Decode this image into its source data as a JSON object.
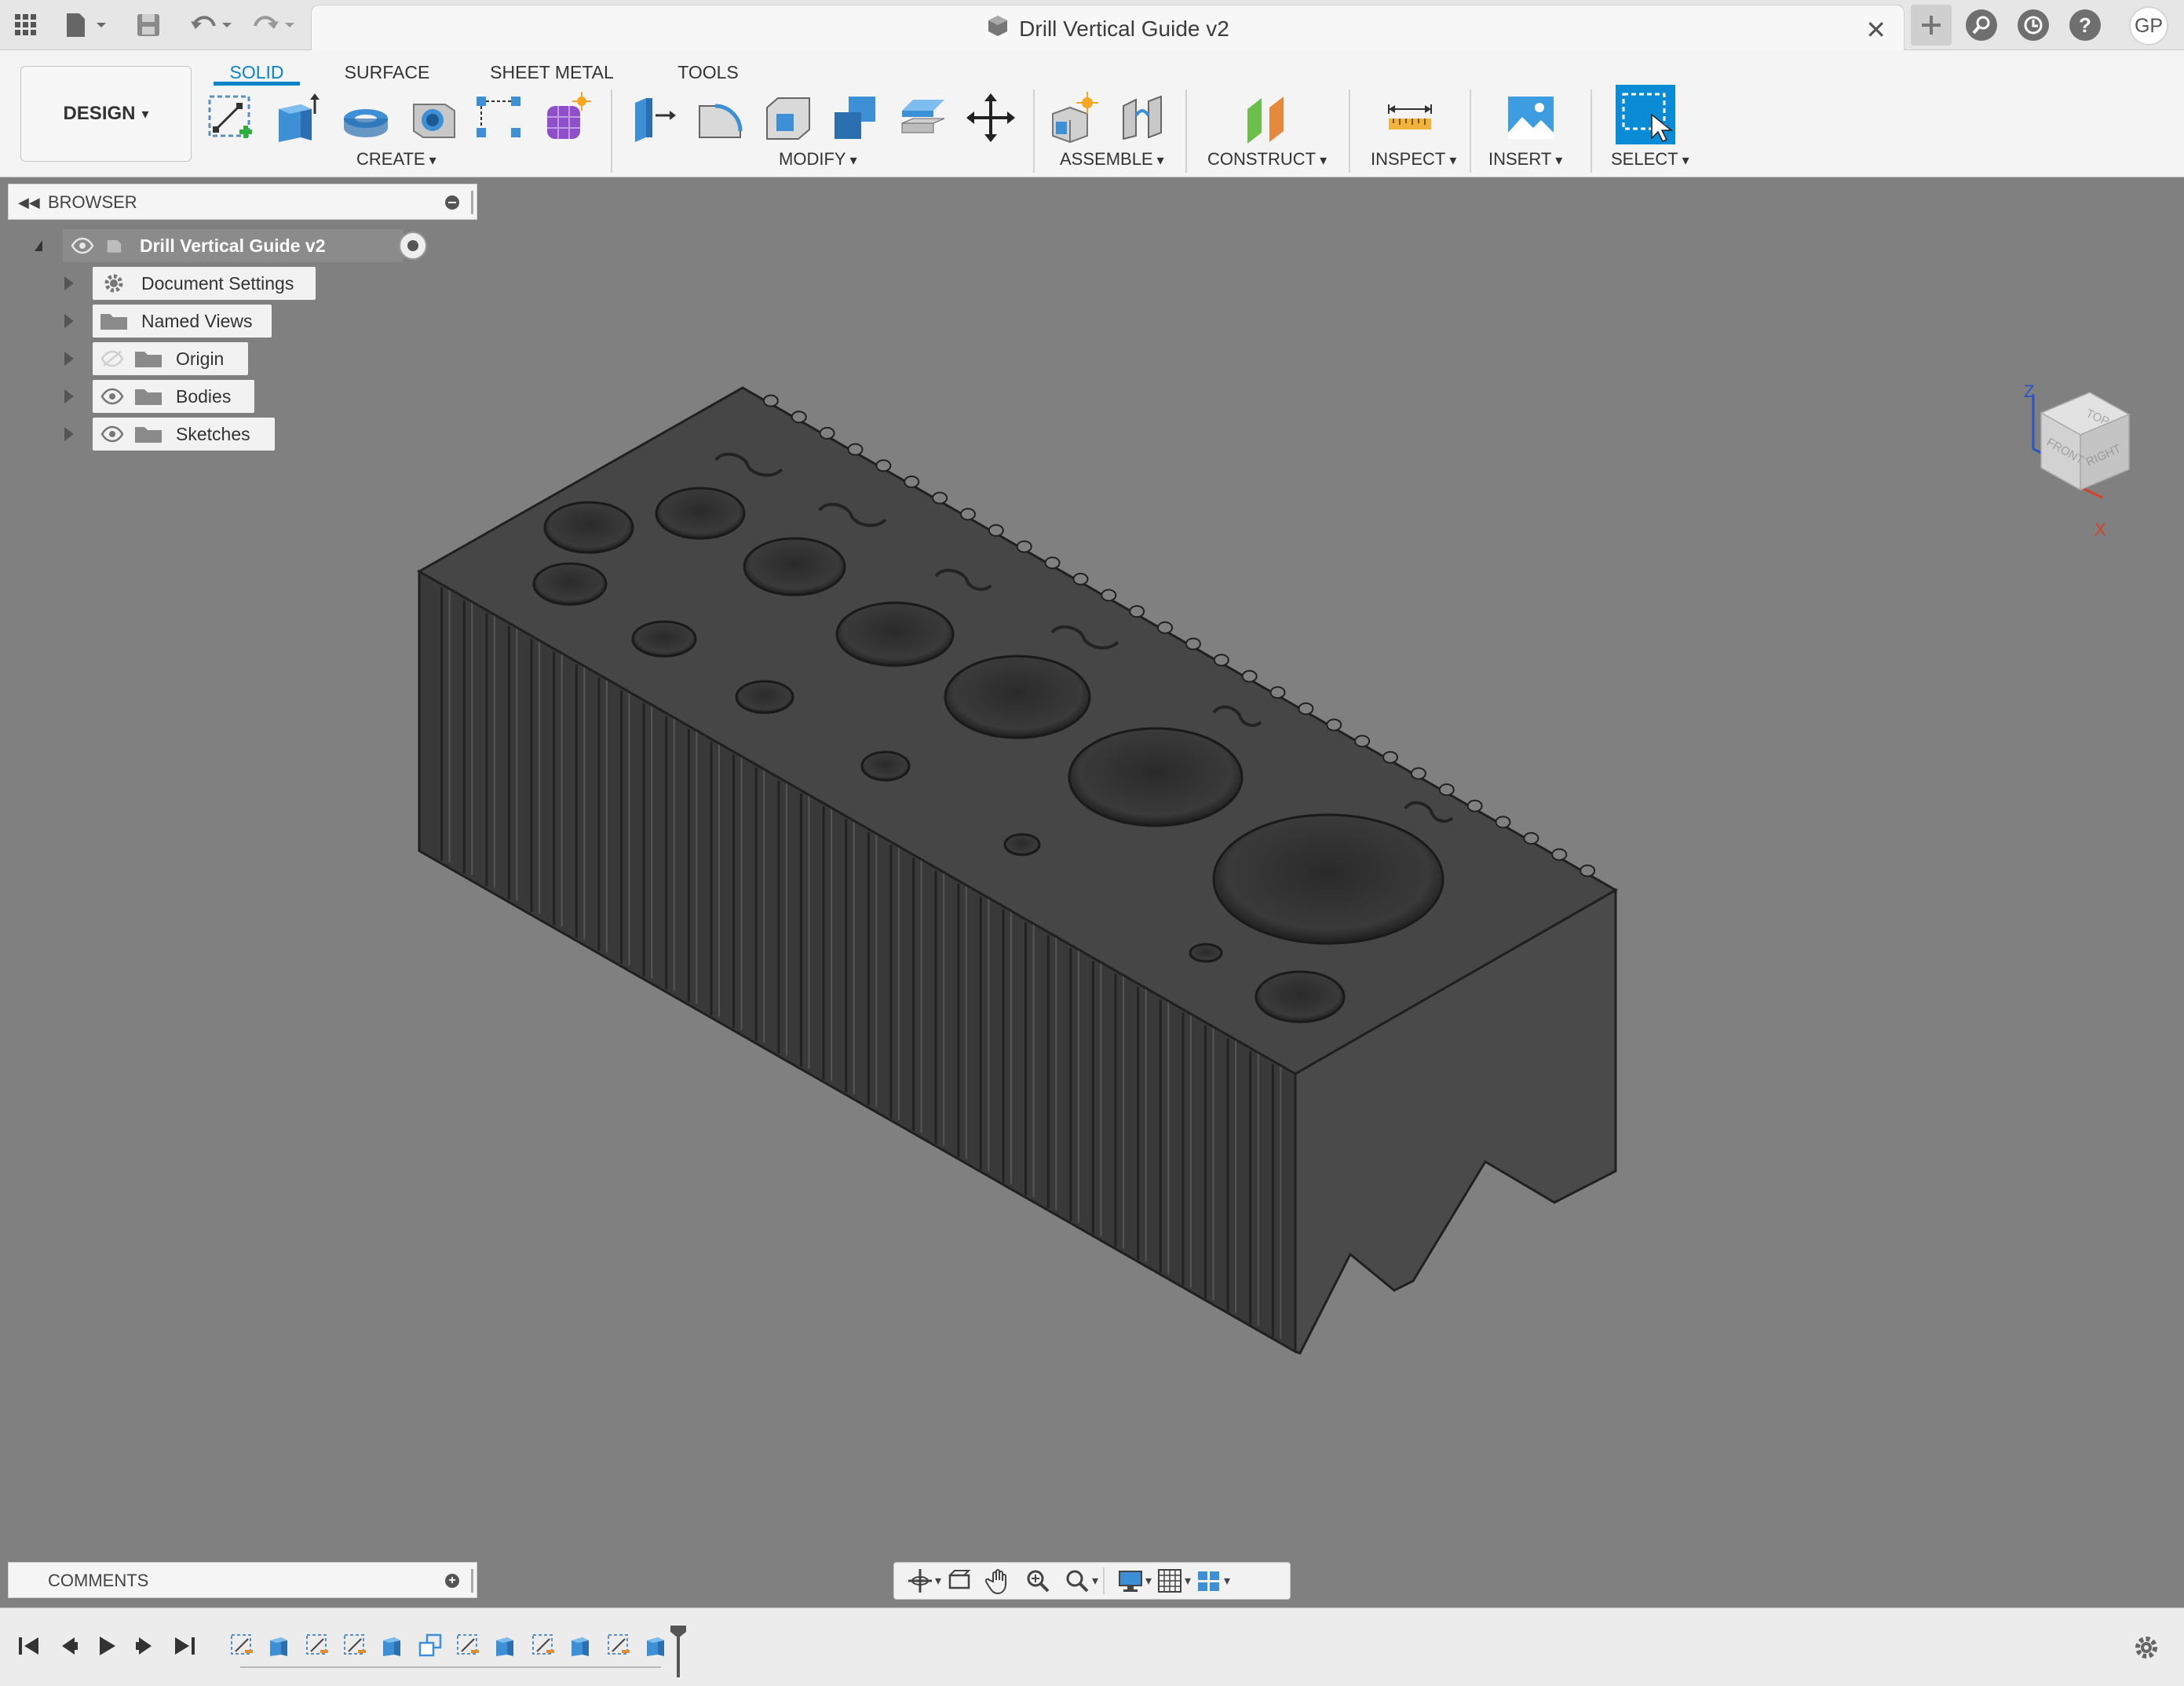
{
  "app": {
    "document_title": "Drill Vertical Guide v2",
    "user_initials": "GP"
  },
  "titlebar": {
    "icons": [
      "apps-grid-icon",
      "file-menu-icon",
      "save-icon",
      "undo-icon",
      "redo-icon"
    ],
    "right_icons": [
      "new-tab-plus-icon",
      "extensions-icon",
      "job-status-icon",
      "help-icon"
    ]
  },
  "toolbar": {
    "workspace_button": "DESIGN",
    "tabs": [
      {
        "label": "SOLID",
        "active": true
      },
      {
        "label": "SURFACE",
        "active": false
      },
      {
        "label": "SHEET METAL",
        "active": false
      },
      {
        "label": "TOOLS",
        "active": false
      }
    ],
    "groups": [
      {
        "label": "CREATE",
        "tools": [
          "create-sketch",
          "extrude",
          "revolve",
          "hole",
          "rectangular-pattern",
          "create-form"
        ]
      },
      {
        "label": "MODIFY",
        "tools": [
          "press-pull",
          "fillet",
          "shell",
          "combine",
          "offset-face",
          "move-copy"
        ]
      },
      {
        "label": "ASSEMBLE",
        "tools": [
          "new-component",
          "joint"
        ]
      },
      {
        "label": "CONSTRUCT",
        "tools": [
          "offset-plane"
        ]
      },
      {
        "label": "INSPECT",
        "tools": [
          "measure"
        ]
      },
      {
        "label": "INSERT",
        "tools": [
          "insert-image"
        ]
      },
      {
        "label": "SELECT",
        "tools": [
          "select"
        ]
      }
    ]
  },
  "browser": {
    "title": "BROWSER",
    "root": "Drill Vertical Guide v2",
    "items": [
      {
        "label": "Document Settings",
        "icon": "gear-icon",
        "eye": "none"
      },
      {
        "label": "Named Views",
        "icon": "folder-icon",
        "eye": "none"
      },
      {
        "label": "Origin",
        "icon": "folder-icon",
        "eye": "hidden"
      },
      {
        "label": "Bodies",
        "icon": "folder-icon",
        "eye": "visible"
      },
      {
        "label": "Sketches",
        "icon": "folder-icon",
        "eye": "visible"
      }
    ]
  },
  "viewcube": {
    "faces": [
      "TOP",
      "FRONT",
      "RIGHT"
    ],
    "axes": [
      "Z",
      "X"
    ]
  },
  "comments": {
    "title": "COMMENTS"
  },
  "navbar": {
    "tools": [
      "orbit-icon",
      "look-at-icon",
      "pan-icon",
      "zoom-icon",
      "fit-icon",
      "display-settings-icon",
      "grid-icon",
      "viewports-icon"
    ]
  },
  "timeline": {
    "playback": [
      "skip-to-start-icon",
      "step-back-icon",
      "play-icon",
      "step-forward-icon",
      "skip-to-end-icon"
    ],
    "features": [
      "sketch",
      "extrude",
      "sketch",
      "sketch",
      "extrude",
      "combine",
      "sketch",
      "extrude",
      "sketch",
      "extrude",
      "sketch",
      "extrude"
    ]
  },
  "colors": {
    "accent": "#0a84c9",
    "viewport_bg": "#808080",
    "model_dark": "#3a3a3a",
    "model_top": "#464646"
  }
}
